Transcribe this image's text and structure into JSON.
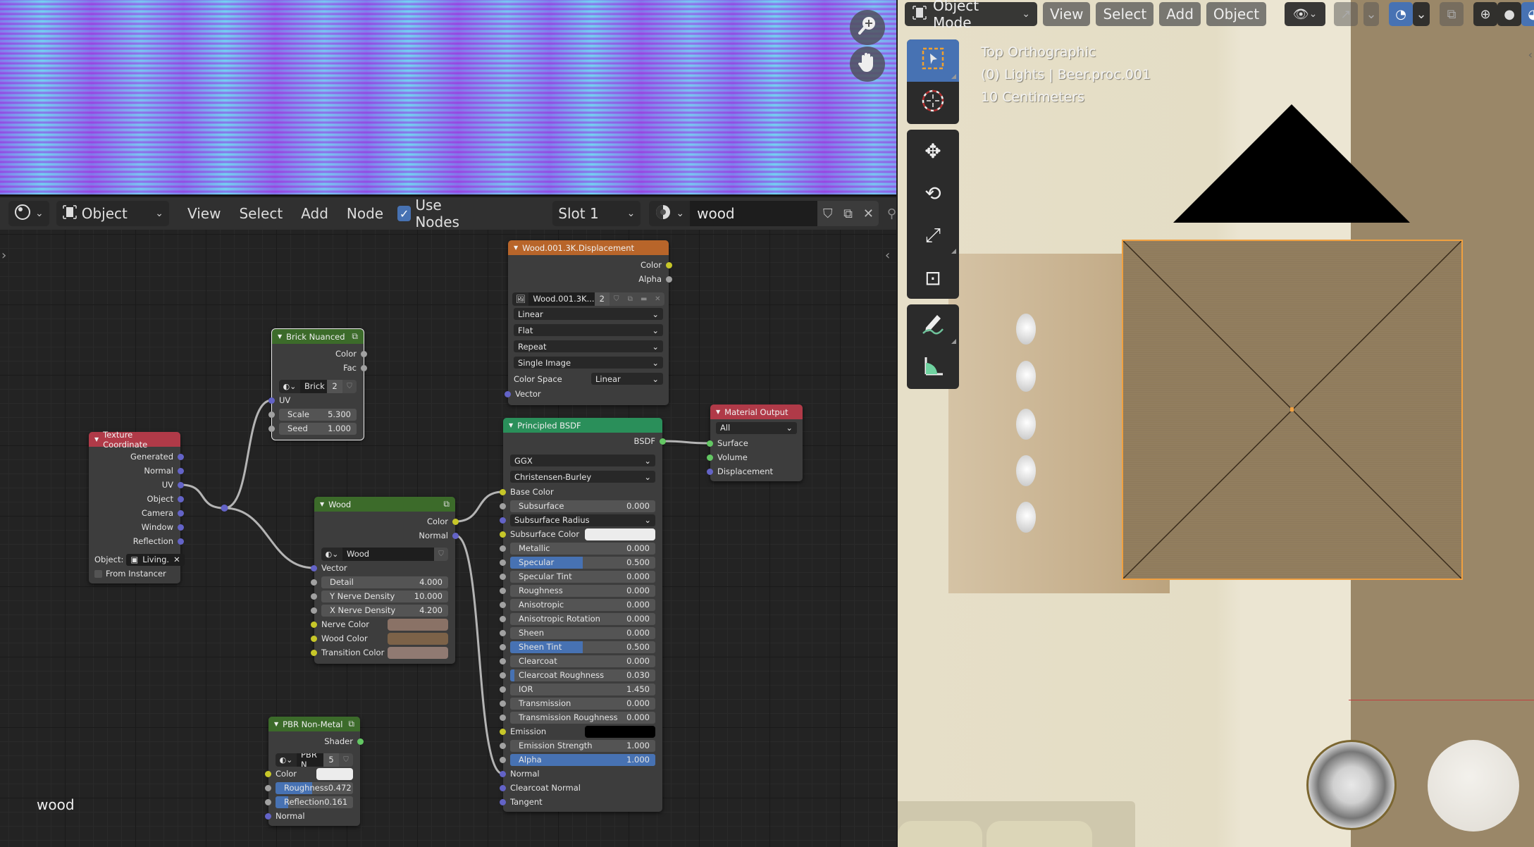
{
  "preview": {
    "zoom_icon": "zoom-in-icon",
    "pan_icon": "hand-pan-icon"
  },
  "node_editor": {
    "header": {
      "editor_type_icon": "shader-editor-icon",
      "object_type": "Object",
      "menus": [
        "View",
        "Select",
        "Add",
        "Node"
      ],
      "use_nodes_label": "Use Nodes",
      "use_nodes_checked": true,
      "slot": "Slot 1",
      "material_name": "wood"
    },
    "caption": "wood",
    "nodes": {
      "displacement": {
        "title": "Wood.001.3K.Displacement",
        "outputs": [
          "Color",
          "Alpha"
        ],
        "image_name": "Wood.001.3K...",
        "user_count": "2",
        "interpolation": "Linear",
        "projection": "Flat",
        "extension": "Repeat",
        "source": "Single Image",
        "color_space_label": "Color Space",
        "color_space": "Linear",
        "inputs": [
          "Vector"
        ],
        "header_color": "#b8652a"
      },
      "brick": {
        "title": "Brick Nuanced",
        "outputs": [
          "Color",
          "Fac"
        ],
        "group_name": "Brick",
        "user_count": "2",
        "uv_label": "UV",
        "fields": [
          {
            "label": "Scale",
            "value": "5.300"
          },
          {
            "label": "Seed",
            "value": "1.000"
          }
        ],
        "header_color": "#3c6b2a"
      },
      "texcoord": {
        "title": "Texture Coordinate",
        "outputs": [
          "Generated",
          "Normal",
          "UV",
          "Object",
          "Camera",
          "Window",
          "Reflection"
        ],
        "object_label": "Object:",
        "object_value": "Living.",
        "from_instancer_label": "From Instancer",
        "from_instancer_checked": false,
        "header_color": "#b03a48"
      },
      "wood": {
        "title": "Wood",
        "outputs": [
          "Color",
          "Normal"
        ],
        "group_name": "Wood",
        "vector_label": "Vector",
        "fields": [
          {
            "label": "Detail",
            "value": "4.000"
          },
          {
            "label": "Y Nerve Density",
            "value": "10.000"
          },
          {
            "label": "X Nerve Density",
            "value": "4.200"
          }
        ],
        "colors": [
          {
            "label": "Nerve Color",
            "value": "#8a7266"
          },
          {
            "label": "Wood Color",
            "value": "#7c6248"
          },
          {
            "label": "Transition Color",
            "value": "#907a72"
          }
        ],
        "header_color": "#3c6b2a"
      },
      "pbr": {
        "title": "PBR Non-Metal",
        "outputs": [
          "Shader"
        ],
        "group_name": "PBR N",
        "user_count": "5",
        "color_label": "Color",
        "color_value": "#ececec",
        "fields": [
          {
            "label": "Roughness",
            "value": "0.472",
            "fraction": 0.472
          },
          {
            "label": "Reflection",
            "value": "0.161",
            "fraction": 0.161
          }
        ],
        "normal_label": "Normal",
        "header_color": "#3c6b2a"
      },
      "principled": {
        "title": "Principled BSDF",
        "outputs": [
          "BSDF"
        ],
        "distribution": "GGX",
        "subsurface_method": "Christensen-Burley",
        "base_color_label": "Base Color",
        "rows": [
          {
            "type": "field",
            "label": "Subsurface",
            "value": "0.000",
            "fraction": 0,
            "socket": "grey"
          },
          {
            "type": "dropdown",
            "label": "Subsurface Radius",
            "socket": "blue"
          },
          {
            "type": "color",
            "label": "Subsurface Color",
            "value": "#ececec",
            "socket": "yellow"
          },
          {
            "type": "field",
            "label": "Metallic",
            "value": "0.000",
            "fraction": 0,
            "socket": "grey"
          },
          {
            "type": "field",
            "label": "Specular",
            "value": "0.500",
            "fraction": 0.5,
            "socket": "grey"
          },
          {
            "type": "field",
            "label": "Specular Tint",
            "value": "0.000",
            "fraction": 0,
            "socket": "grey"
          },
          {
            "type": "field",
            "label": "Roughness",
            "value": "0.000",
            "fraction": 0,
            "socket": "grey"
          },
          {
            "type": "field",
            "label": "Anisotropic",
            "value": "0.000",
            "fraction": 0,
            "socket": "grey"
          },
          {
            "type": "field",
            "label": "Anisotropic Rotation",
            "value": "0.000",
            "fraction": 0,
            "socket": "grey"
          },
          {
            "type": "field",
            "label": "Sheen",
            "value": "0.000",
            "fraction": 0,
            "socket": "grey"
          },
          {
            "type": "field",
            "label": "Sheen Tint",
            "value": "0.500",
            "fraction": 0.5,
            "socket": "grey"
          },
          {
            "type": "field",
            "label": "Clearcoat",
            "value": "0.000",
            "fraction": 0,
            "socket": "grey"
          },
          {
            "type": "field",
            "label": "Clearcoat Roughness",
            "value": "0.030",
            "fraction": 0.03,
            "socket": "grey"
          },
          {
            "type": "field",
            "label": "IOR",
            "value": "1.450",
            "fraction": 0,
            "socket": "grey"
          },
          {
            "type": "field",
            "label": "Transmission",
            "value": "0.000",
            "fraction": 0,
            "socket": "grey"
          },
          {
            "type": "field",
            "label": "Transmission Roughness",
            "value": "0.000",
            "fraction": 0,
            "socket": "grey"
          },
          {
            "type": "color",
            "label": "Emission",
            "value": "#000000",
            "socket": "yellow"
          },
          {
            "type": "field",
            "label": "Emission Strength",
            "value": "1.000",
            "fraction": 0,
            "socket": "grey"
          },
          {
            "type": "field",
            "label": "Alpha",
            "value": "1.000",
            "fraction": 1,
            "socket": "grey"
          },
          {
            "type": "label",
            "label": "Normal",
            "socket": "blue"
          },
          {
            "type": "label",
            "label": "Clearcoat Normal",
            "socket": "blue"
          },
          {
            "type": "label",
            "label": "Tangent",
            "socket": "blue"
          }
        ],
        "header_color": "#2a8f5a"
      },
      "output": {
        "title": "Material Output",
        "target": "All",
        "inputs": [
          "Surface",
          "Volume",
          "Displacement"
        ],
        "header_color": "#b03a48"
      }
    }
  },
  "viewport": {
    "mode": "Object Mode",
    "menus": [
      "View",
      "Select",
      "Add",
      "Object"
    ],
    "info": {
      "view_name": "Top Orthographic",
      "collection": "(0) Lights | Beer.proc.001",
      "scale": "10 Centimeters"
    },
    "tools": [
      "select-box",
      "cursor",
      "move",
      "rotate",
      "scale",
      "transform",
      "annotate",
      "measure"
    ],
    "active_tool": "select-box",
    "accent": "#4772b3",
    "selection_outline": "#f0a040"
  }
}
